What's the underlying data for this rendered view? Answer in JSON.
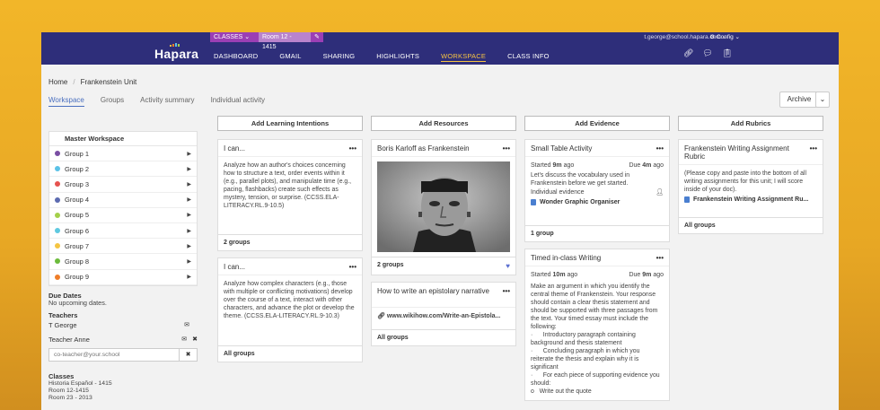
{
  "topbar": {
    "classes_label": "CLASSES",
    "room_label": "Room 12 - 1415",
    "logo": "Hapara",
    "user_email": "t.george@school.hapara.com",
    "config_label": "Config",
    "nav": [
      "DASHBOARD",
      "GMAIL",
      "SHARING",
      "HIGHLIGHTS",
      "WORKSPACE",
      "CLASS INFO"
    ],
    "active_nav": "WORKSPACE"
  },
  "breadcrumb": {
    "home": "Home",
    "current": "Frankenstein Unit"
  },
  "subnav": [
    "Workspace",
    "Groups",
    "Activity summary",
    "Individual activity"
  ],
  "archive_label": "Archive",
  "sidebar": {
    "groups_header": "Master Workspace",
    "groups": [
      {
        "name": "Group 1",
        "color": "#7a4ea3"
      },
      {
        "name": "Group 2",
        "color": "#5bc2e7"
      },
      {
        "name": "Group 3",
        "color": "#e6534f"
      },
      {
        "name": "Group 4",
        "color": "#5c6bb0"
      },
      {
        "name": "Group 5",
        "color": "#a4d04a"
      },
      {
        "name": "Group 6",
        "color": "#5fc9e0"
      },
      {
        "name": "Group 7",
        "color": "#f5c542"
      },
      {
        "name": "Group 8",
        "color": "#6cbb3c"
      },
      {
        "name": "Group 9",
        "color": "#ef7d28"
      }
    ],
    "due_dates_label": "Due Dates",
    "due_dates_text": "No upcoming dates.",
    "teachers_label": "Teachers",
    "teachers": [
      "T George",
      "Teacher Anne"
    ],
    "coteacher_placeholder": "co-teacher@your.school",
    "classes_label": "Classes",
    "classes": [
      "Historia Español - 1415",
      "Room 12-1415",
      "Room 23 - 2013"
    ]
  },
  "columns": {
    "learning": {
      "button": "Add Learning Intentions",
      "cards": [
        {
          "title": "I can...",
          "text": "Analyze how an author's choices concerning how to structure a text, order events within it (e.g., parallel plots), and manipulate time (e.g., pacing, flashbacks) create such effects as mystery, tension, or surprise. (CCSS.ELA-LITERACY.RL.9-10.5)",
          "footer": "2 groups"
        },
        {
          "title": "I can...",
          "text": "Analyze how complex characters (e.g., those with multiple or conflicting motivations) develop over the course of a text, interact with other characters, and advance the plot or develop the theme. (CCSS.ELA-LITERACY.RL.9-10.3)",
          "footer": "All groups"
        }
      ]
    },
    "resources": {
      "button": "Add Resources",
      "cards": [
        {
          "title": "Boris Karloff as Frankenstein",
          "footer": "2 groups"
        },
        {
          "title": "How to write an epistolary narrative",
          "link": "www.wikihow.com/Write-an-Epistola...",
          "footer": "All groups"
        }
      ]
    },
    "evidence": {
      "button": "Add Evidence",
      "cards": [
        {
          "title": "Small Table Activity",
          "started_prefix": "Started",
          "started_value": "9m",
          "started_suffix": "ago",
          "due_prefix": "Due",
          "due_value": "4m",
          "due_suffix": "ago",
          "text": "Let's discuss the vocabulary used in Frankenstein before we get started.",
          "type": "Individual evidence",
          "doc": "Wonder Graphic Organiser",
          "footer": "1 group"
        },
        {
          "title": "Timed in-class Writing",
          "started_prefix": "Started",
          "started_value": "10m",
          "started_suffix": "ago",
          "due_prefix": "Due",
          "due_value": "9m",
          "due_suffix": "ago",
          "lines": [
            "Make an argument in which you identify the central theme of Frankenstein. Your response should contain a clear thesis statement and should be supported with three passages from the text.  Your timed essay must include the following:",
            "·      Introductory paragraph containing background and thesis statement",
            "·      Concluding paragraph in which you reiterate the thesis and explain why it is significant",
            "·      For each piece of supporting evidence you should:",
            "o   Write out the quote"
          ]
        }
      ]
    },
    "rubrics": {
      "button": "Add Rubrics",
      "cards": [
        {
          "title": "Frankenstein Writing Assignment Rubric",
          "text": "(Please copy and paste into the bottom of all writing assignments for this unit; I will score inside of your doc).",
          "doc": "Frankenstein Writing Assignment Ru...",
          "footer": "All groups"
        }
      ]
    }
  }
}
